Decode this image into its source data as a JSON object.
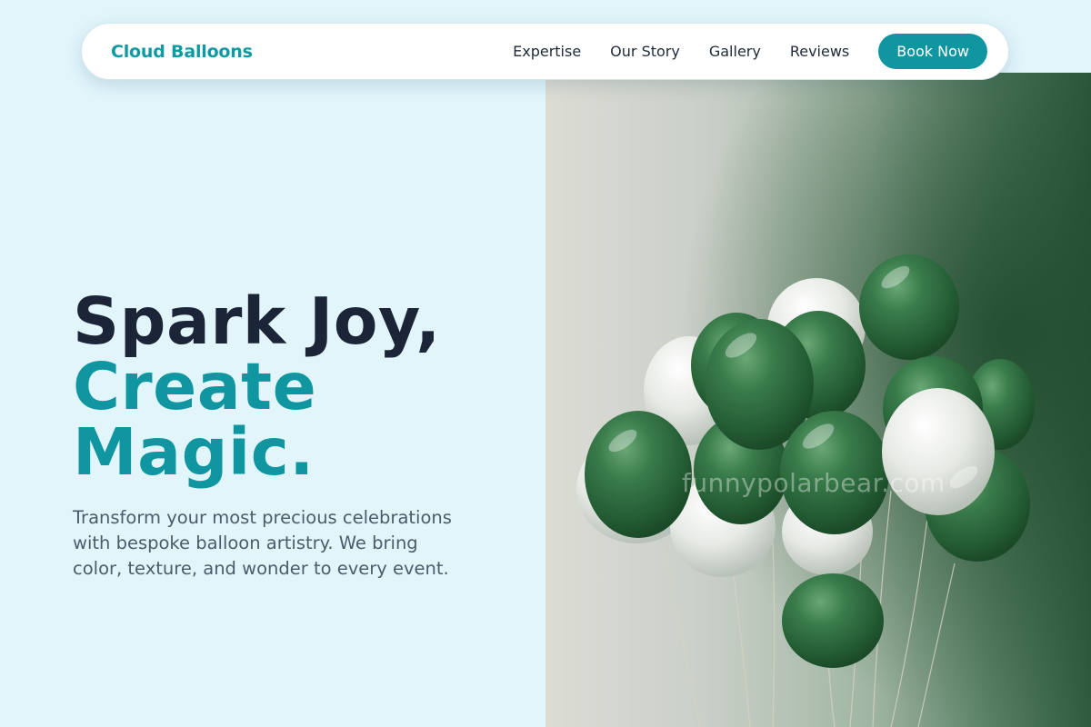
{
  "nav": {
    "brand": "Cloud Balloons",
    "links": [
      "Expertise",
      "Our Story",
      "Gallery",
      "Reviews"
    ],
    "cta": "Book Now"
  },
  "hero": {
    "headline_line1": "Spark Joy,",
    "headline_line2": "Create",
    "headline_line3": "Magic.",
    "subtext": "Transform your most precious celebrations with bespoke balloon artistry. We bring color, texture, and wonder to every event.",
    "image_watermark": "funnypolarbear.com"
  },
  "colors": {
    "background": "#e1f5fb",
    "accent": "#0f96a1",
    "headline": "#1c2438",
    "body_text": "#4d5b6a",
    "balloon_green": "#2f6e3f",
    "balloon_white": "#e9ece8"
  }
}
